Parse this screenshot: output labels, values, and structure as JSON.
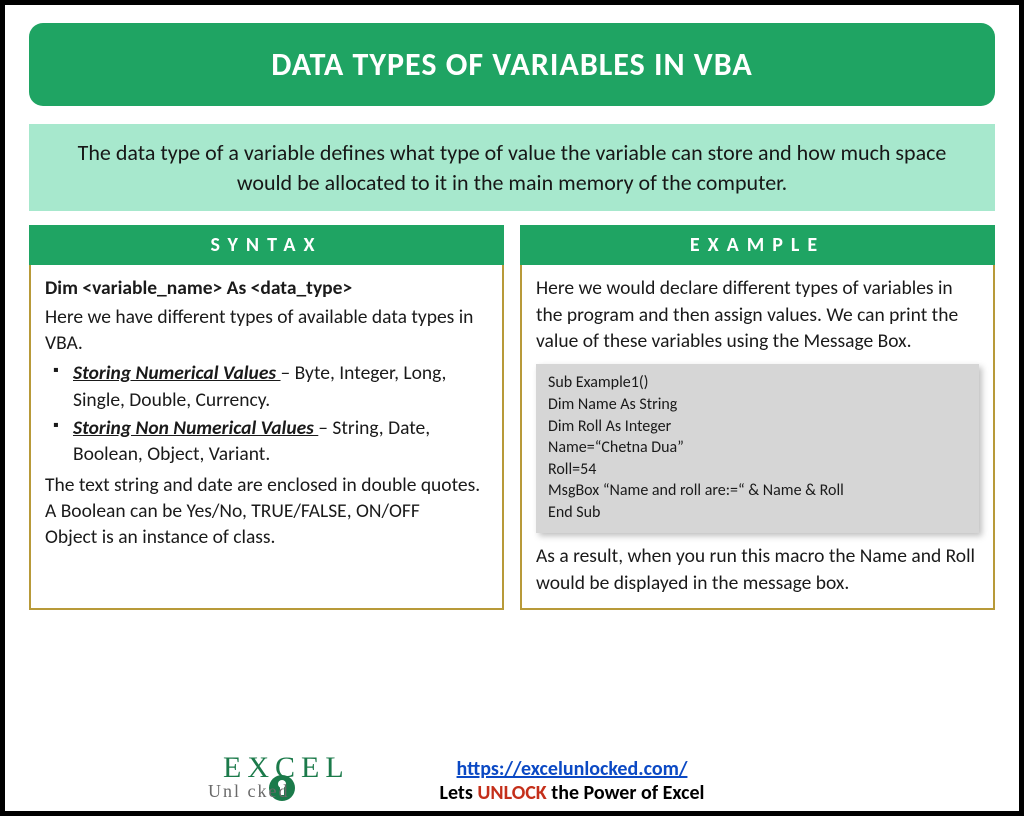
{
  "title": "DATA TYPES OF VARIABLES IN VBA",
  "intro": "The data type of a variable defines what type of value the variable can store and how much space would be allocated to it in the main memory of the computer.",
  "left": {
    "header": "SYNTAX",
    "syntax_line": "Dim <variable_name> As <data_type>",
    "lead": "Here we have different types of available data types in VBA.",
    "bullets": [
      {
        "label": "Storing Numerical Values ",
        "rest": "– Byte, Integer, Long, Single, Double, Currency."
      },
      {
        "label": "Storing Non Numerical Values ",
        "rest": "– String, Date, Boolean, Object, Variant."
      }
    ],
    "tail1": "The text string and date are enclosed in double quotes.",
    "tail2": "A Boolean can be Yes/No, TRUE/FALSE, ON/OFF",
    "tail3": "Object is an instance of class."
  },
  "right": {
    "header": "EXAMPLE",
    "intro": "Here we would declare different types of variables in the program and then assign values. We can print the value of these variables using the Message Box.",
    "code": [
      "Sub Example1()",
      "Dim Name As String",
      "Dim Roll As Integer",
      "Name=“Chetna Dua”",
      "Roll=54",
      "MsgBox “Name and roll are:=“ & Name & Roll",
      "End Sub"
    ],
    "outro": "As a result, when you run this macro the Name and Roll would be displayed in the message box."
  },
  "footer": {
    "url": "https://excelunlocked.com/",
    "tag_pre": "Lets ",
    "tag_unlock": "UNLOCK",
    "tag_post": " the Power of Excel",
    "logo_top": "EXCEL",
    "logo_bottom": "Unl   cked"
  }
}
